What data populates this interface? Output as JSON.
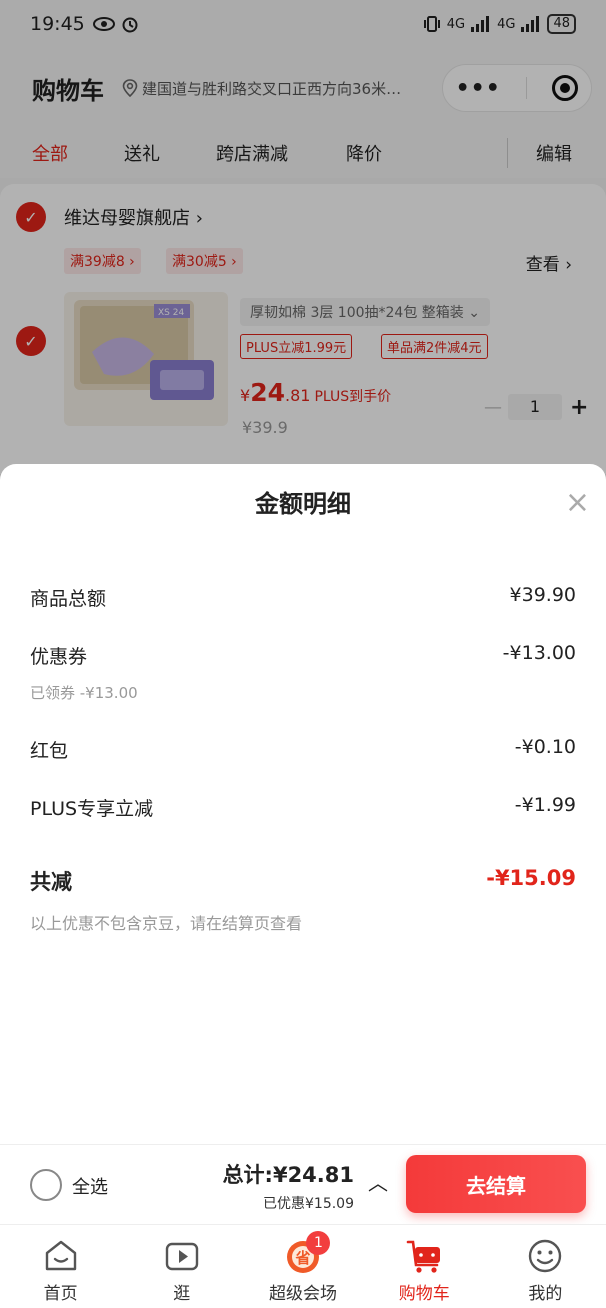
{
  "status_bar": {
    "time": "19:45",
    "network1": "4G",
    "network2": "4G",
    "battery": "48"
  },
  "header": {
    "title": "购物车",
    "location": "建国道与胜利路交叉口正西方向36米…"
  },
  "tabs": [
    {
      "label": "全部",
      "active": true
    },
    {
      "label": "送礼"
    },
    {
      "label": "跨店满减"
    },
    {
      "label": "降价"
    },
    {
      "label": "编辑"
    }
  ],
  "store": {
    "name": "维达母婴旗舰店",
    "promos": [
      "满39减8",
      "满30减5"
    ],
    "view_more": "查看",
    "product": {
      "spec": "厚韧如棉 3层 100抽*24包 整箱装",
      "badges": [
        "PLUS立减1.99元",
        "单品满2件减4元"
      ],
      "price_yen": "¥",
      "price_int": "24",
      "price_dec": ".81",
      "price_note": "PLUS到手价",
      "original_price": "¥39.9",
      "quantity": "1",
      "image_text": "XS 24"
    }
  },
  "sheet": {
    "title": "金额明细",
    "rows": [
      {
        "label": "商品总额",
        "value": "¥39.90"
      },
      {
        "label": "优惠券",
        "value": "-¥13.00",
        "sub": "已领券 -¥13.00"
      },
      {
        "label": "红包",
        "value": "-¥0.10"
      },
      {
        "label": "PLUS专享立减",
        "value": "-¥1.99"
      }
    ],
    "total_label": "共减",
    "total_value": "-¥15.09",
    "note": "以上优惠不包含京豆，请在结算页查看"
  },
  "checkout": {
    "select_all": "全选",
    "total": "总计:¥24.81",
    "saved": "已优惠¥15.09",
    "button": "去结算"
  },
  "nav": [
    {
      "label": "首页",
      "icon": "home-icon"
    },
    {
      "label": "逛",
      "icon": "video-icon"
    },
    {
      "label": "超级会场",
      "icon": "super-venue-icon",
      "badge": "1"
    },
    {
      "label": "购物车",
      "icon": "cart-icon",
      "active": true
    },
    {
      "label": "我的",
      "icon": "smiley-icon"
    }
  ],
  "colors": {
    "accent": "#e1251b",
    "button": "#f43a3a"
  }
}
